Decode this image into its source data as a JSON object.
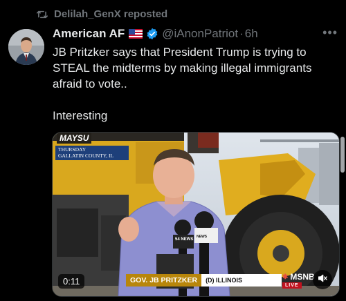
{
  "repost": {
    "label": "Delilah_GenX reposted",
    "icon": "repost-icon"
  },
  "author": {
    "name": "American AF",
    "flag": "US flag",
    "verified": true,
    "handle": "@iAnonPatriot",
    "separator": "·",
    "time": "6h"
  },
  "tweet": {
    "paragraph1": "JB Pritzker says that President Trump is trying to STEAL the midterms by making illegal immigrants afraid to vote..",
    "paragraph2": "Interesting"
  },
  "media": {
    "machine_brand": "MAYSU",
    "date_bug_line1": "THURSDAY",
    "date_bug_line2": "GALLATIN COUNTY, IL",
    "lower_third_name": "GOV. JB PRITZKER",
    "lower_third_party": "(D) ILLINOIS",
    "network": "MSNB",
    "live": "LIVE",
    "duration": "0:11",
    "mic_flag": "54 NEWS",
    "mic_flag2": "NEWS"
  },
  "colors": {
    "background": "#000000",
    "text": "#e7e9ea",
    "muted": "#71767b",
    "verified": "#1d9bf0",
    "lower_third_gold": "#b8860b"
  }
}
